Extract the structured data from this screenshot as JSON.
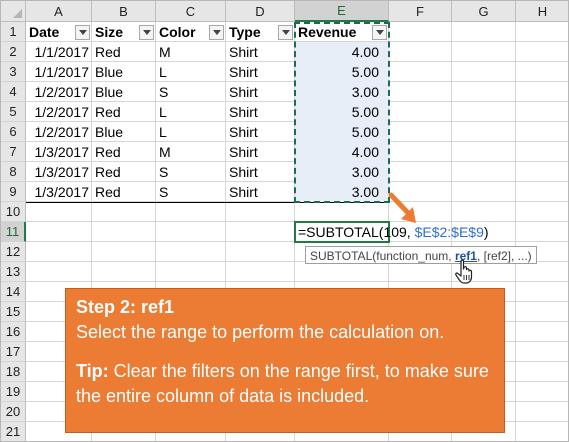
{
  "columns": [
    "A",
    "B",
    "C",
    "D",
    "E",
    "F",
    "G",
    "H"
  ],
  "rows": [
    "1",
    "2",
    "3",
    "4",
    "5",
    "6",
    "7",
    "8",
    "9",
    "10",
    "11",
    "12",
    "13",
    "14",
    "15",
    "16",
    "17",
    "18",
    "19",
    "20",
    "21"
  ],
  "table": {
    "headers": [
      "Date",
      "Size",
      "Color",
      "Type",
      "Revenue"
    ],
    "data": [
      [
        "1/1/2017",
        "Red",
        "M",
        "Shirt",
        "4.00"
      ],
      [
        "1/1/2017",
        "Blue",
        "L",
        "Shirt",
        "5.00"
      ],
      [
        "1/2/2017",
        "Blue",
        "S",
        "Shirt",
        "3.00"
      ],
      [
        "1/2/2017",
        "Red",
        "L",
        "Shirt",
        "5.00"
      ],
      [
        "1/2/2017",
        "Blue",
        "L",
        "Shirt",
        "5.00"
      ],
      [
        "1/3/2017",
        "Red",
        "M",
        "Shirt",
        "4.00"
      ],
      [
        "1/3/2017",
        "Red",
        "S",
        "Shirt",
        "3.00"
      ],
      [
        "1/3/2017",
        "Red",
        "S",
        "Shirt",
        "3.00"
      ]
    ]
  },
  "formula": {
    "prefix": "=SUBTOTAL(109, ",
    "ref": "$E$2:$E$9",
    "suffix": ")"
  },
  "tooltip": {
    "fn": "SUBTOTAL(function_num, ",
    "active_arg": "ref1",
    "rest": ", [ref2], ...)"
  },
  "callout": {
    "title": "Step 2: ref1",
    "body": "Select the range to perform the calculation on.",
    "tip_label": "Tip:",
    "tip_text": " Clear the filters on the range first, to make sure the entire column of data is included."
  },
  "colors": {
    "callout": "#ec7b34",
    "selection": "#1f7a43",
    "reference": "#2e6fd1",
    "revenue_fill": "#e8eef8"
  }
}
